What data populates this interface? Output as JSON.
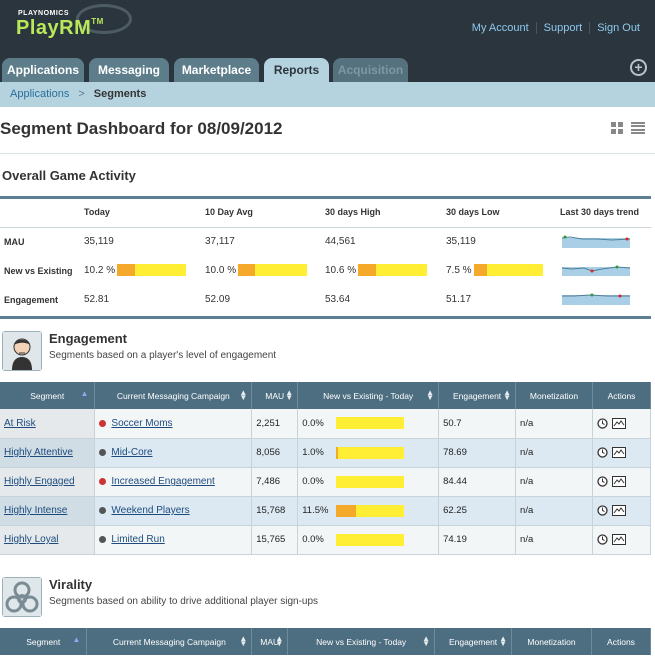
{
  "header": {
    "logo_small": "PLAYNOMICS",
    "logo_big": "PlayRM",
    "logo_tm": "TM",
    "links": [
      "My Account",
      "Support",
      "Sign Out"
    ]
  },
  "tabs": [
    {
      "label": "Applications",
      "state": "normal"
    },
    {
      "label": "Messaging",
      "state": "normal"
    },
    {
      "label": "Marketplace",
      "state": "normal"
    },
    {
      "label": "Reports",
      "state": "active"
    },
    {
      "label": "Acquisition",
      "state": "disabled"
    }
  ],
  "breadcrumb": {
    "root": "Applications",
    "separator": ">",
    "current": "Segments"
  },
  "page_title": "Segment Dashboard for 08/09/2012",
  "overall": {
    "title": "Overall Game Activity",
    "columns": [
      "Today",
      "10 Day Avg",
      "30 days High",
      "30 days Low",
      "Last 30 days trend"
    ],
    "rows": [
      {
        "label": "MAU",
        "values": [
          "35,119",
          "37,117",
          "44,561",
          "35,119"
        ]
      },
      {
        "label": "New vs Existing",
        "values": [
          "10.2 %",
          "10.0 %",
          "10.6 %",
          "7.5 %"
        ],
        "bars": [
          0.102,
          0.1,
          0.106,
          0.075
        ]
      },
      {
        "label": "Engagement",
        "values": [
          "52.81",
          "52.09",
          "53.64",
          "51.17"
        ]
      }
    ]
  },
  "engagement": {
    "title": "Engagement",
    "description": "Segments based on a player's level of engagement",
    "columns": [
      "Segment",
      "Current Messaging Campaign",
      "MAU",
      "New vs Existing - Today",
      "Engagement",
      "Monetization",
      "Actions"
    ],
    "rows": [
      {
        "segment": "At Risk",
        "campaign": "Soccer Moms",
        "dot": "#cc3333",
        "mau": "2,251",
        "nve": "0.0%",
        "nve_value": 0.0,
        "engagement": "50.7",
        "monetization": "n/a"
      },
      {
        "segment": "Highly Attentive",
        "campaign": "Mid-Core",
        "dot": "#555555",
        "mau": "8,056",
        "nve": "1.0%",
        "nve_value": 0.01,
        "engagement": "78.69",
        "monetization": "n/a"
      },
      {
        "segment": "Highly Engaged",
        "campaign": "Increased Engagement",
        "dot": "#cc3333",
        "mau": "7,486",
        "nve": "0.0%",
        "nve_value": 0.0,
        "engagement": "84.44",
        "monetization": "n/a"
      },
      {
        "segment": "Highly Intense",
        "campaign": "Weekend Players",
        "dot": "#555555",
        "mau": "15,768",
        "nve": "11.5%",
        "nve_value": 0.115,
        "engagement": "62.25",
        "monetization": "n/a"
      },
      {
        "segment": "Highly Loyal",
        "campaign": "Limited Run",
        "dot": "#555555",
        "mau": "15,765",
        "nve": "0.0%",
        "nve_value": 0.0,
        "engagement": "74.19",
        "monetization": "n/a"
      }
    ]
  },
  "virality": {
    "title": "Virality",
    "description": "Segments based on ability to drive additional player sign-ups",
    "columns": [
      "Segment",
      "Current Messaging Campaign",
      "MAU",
      "New vs Existing - Today",
      "Engagement",
      "Monetization",
      "Actions"
    ]
  },
  "colors": {
    "header": "#2b353d",
    "tab": "#5d7d8b",
    "tab_active": "#b5d3df",
    "table_header": "#4d6e80",
    "bar": "#ffee33",
    "bar_fill": "#f4a92a",
    "link": "#1d4b7e"
  },
  "icons": [
    "plus-icon",
    "grid-view-icon",
    "list-view-icon",
    "sort-icon",
    "clock-icon",
    "chart-icon",
    "avatar-icon",
    "biohazard-icon"
  ]
}
